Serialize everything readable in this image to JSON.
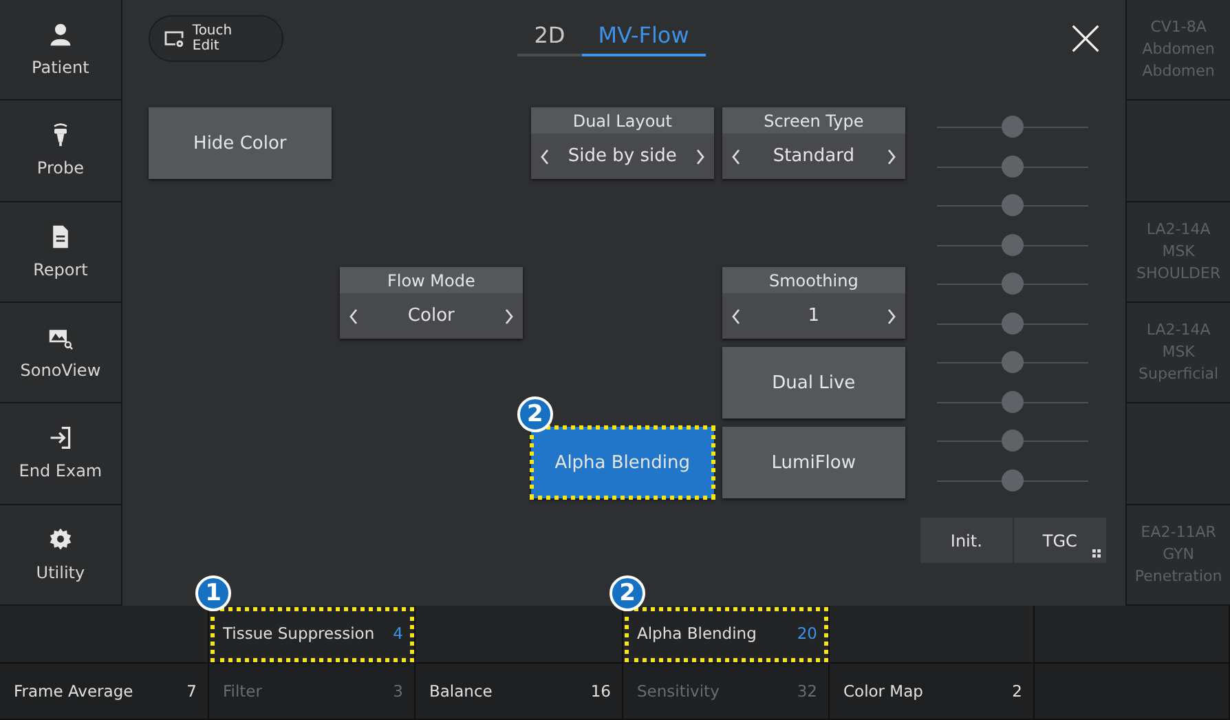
{
  "sidebar": {
    "items": [
      {
        "kind": "patient",
        "label": "Patient"
      },
      {
        "kind": "probe",
        "label": "Probe"
      },
      {
        "kind": "report",
        "label": "Report"
      },
      {
        "kind": "sonoview",
        "label": "SonoView"
      },
      {
        "kind": "end-exam",
        "label": "End Exam"
      },
      {
        "kind": "utility",
        "label": "Utility"
      }
    ]
  },
  "touch_edit": {
    "label_lines": [
      "Touch",
      "Edit"
    ]
  },
  "tabs": [
    {
      "label": "2D",
      "selected": false
    },
    {
      "label": "MV-Flow",
      "selected": true
    }
  ],
  "controls": [
    {
      "kind": "button",
      "label": "Hide Color",
      "active": false
    },
    {
      "kind": "selector",
      "title": "Dual Layout",
      "value": "Side by side"
    },
    {
      "kind": "selector",
      "title": "Screen Type",
      "value": "Standard"
    },
    {
      "kind": "selector",
      "title": "Flow Mode",
      "value": "Color"
    },
    {
      "kind": "selector",
      "title": "Smoothing",
      "value": "1"
    },
    {
      "kind": "button",
      "label": "Dual Live",
      "active": false
    },
    {
      "kind": "button",
      "label": "Alpha Blending",
      "active": true,
      "callout": "2"
    },
    {
      "kind": "button",
      "label": "LumiFlow",
      "active": false
    }
  ],
  "tgc": {
    "sliders": [
      {
        "level": 0.5
      },
      {
        "level": 0.5
      },
      {
        "level": 0.5
      },
      {
        "level": 0.5
      },
      {
        "level": 0.5
      },
      {
        "level": 0.5
      },
      {
        "level": 0.5
      },
      {
        "level": 0.5
      },
      {
        "level": 0.5
      },
      {
        "level": 0.5
      }
    ],
    "buttons": [
      "Init.",
      "TGC"
    ]
  },
  "probes": [
    {
      "kind": "probe",
      "lines": [
        "CV1-8A",
        "Abdomen",
        "Abdomen"
      ]
    },
    {
      "kind": "empty"
    },
    {
      "kind": "probe",
      "lines": [
        "LA2-14A",
        "MSK",
        "SHOULDER"
      ]
    },
    {
      "kind": "probe",
      "lines": [
        "LA2-14A",
        "MSK",
        "Superficial"
      ]
    },
    {
      "kind": "empty"
    },
    {
      "kind": "probe",
      "lines": [
        "EA2-11AR",
        "GYN",
        "Penetration"
      ]
    }
  ],
  "softkeys": {
    "top_row": [
      {
        "kind": "empty"
      },
      {
        "kind": "param",
        "label": "Tissue Suppression",
        "value": "4",
        "disabled": false,
        "callout": "1"
      },
      {
        "kind": "empty"
      },
      {
        "kind": "param",
        "label": "Alpha Blending",
        "value": "20",
        "disabled": false,
        "callout": "2"
      },
      {
        "kind": "empty"
      },
      {
        "kind": "empty"
      }
    ],
    "bottom_row": [
      {
        "kind": "param",
        "label": "Frame Average",
        "value": "7",
        "disabled": false
      },
      {
        "kind": "param",
        "label": "Filter",
        "value": "3",
        "disabled": true
      },
      {
        "kind": "param",
        "label": "Balance",
        "value": "16",
        "disabled": false
      },
      {
        "kind": "param",
        "label": "Sensitivity",
        "value": "32",
        "disabled": true
      },
      {
        "kind": "param",
        "label": "Color Map",
        "value": "2",
        "disabled": false
      },
      {
        "kind": "empty"
      }
    ]
  }
}
